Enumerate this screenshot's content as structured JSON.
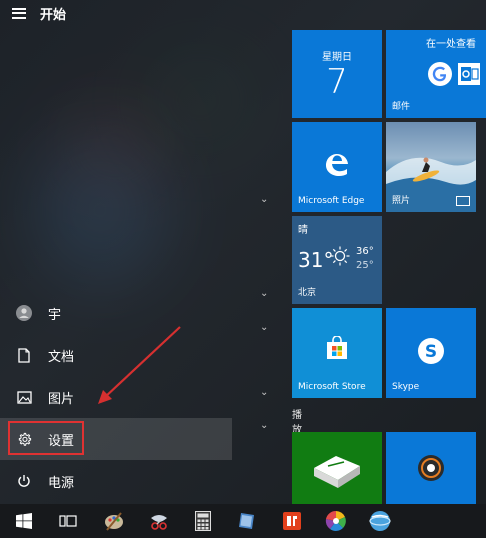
{
  "menu": {
    "title": "开始"
  },
  "left_rail": {
    "user": "宇",
    "documents": "文档",
    "pictures": "图片",
    "settings": "设置",
    "power": "电源"
  },
  "tiles": {
    "calendar": {
      "weekday": "星期日",
      "day": "7"
    },
    "mail": {
      "header": "在一处查看",
      "label": "邮件"
    },
    "edge": {
      "label": "Microsoft Edge"
    },
    "photos": {
      "label": "照片"
    },
    "weather": {
      "condition": "晴",
      "temp": "31°",
      "high": "36°",
      "low": "25°",
      "city": "北京"
    },
    "store": {
      "label": "Microsoft Store"
    },
    "skype": {
      "label": "Skype"
    }
  },
  "group_label": "播放和浏览",
  "icons": {
    "windows": "windows-logo-icon",
    "task_view": "task-view-icon",
    "settings": "gear-icon",
    "power": "power-icon"
  },
  "colors": {
    "tile_blue": "#0a78d7",
    "store_blue": "#108fd6",
    "xbox_green": "#117c12",
    "highlight_red": "#e03232"
  }
}
